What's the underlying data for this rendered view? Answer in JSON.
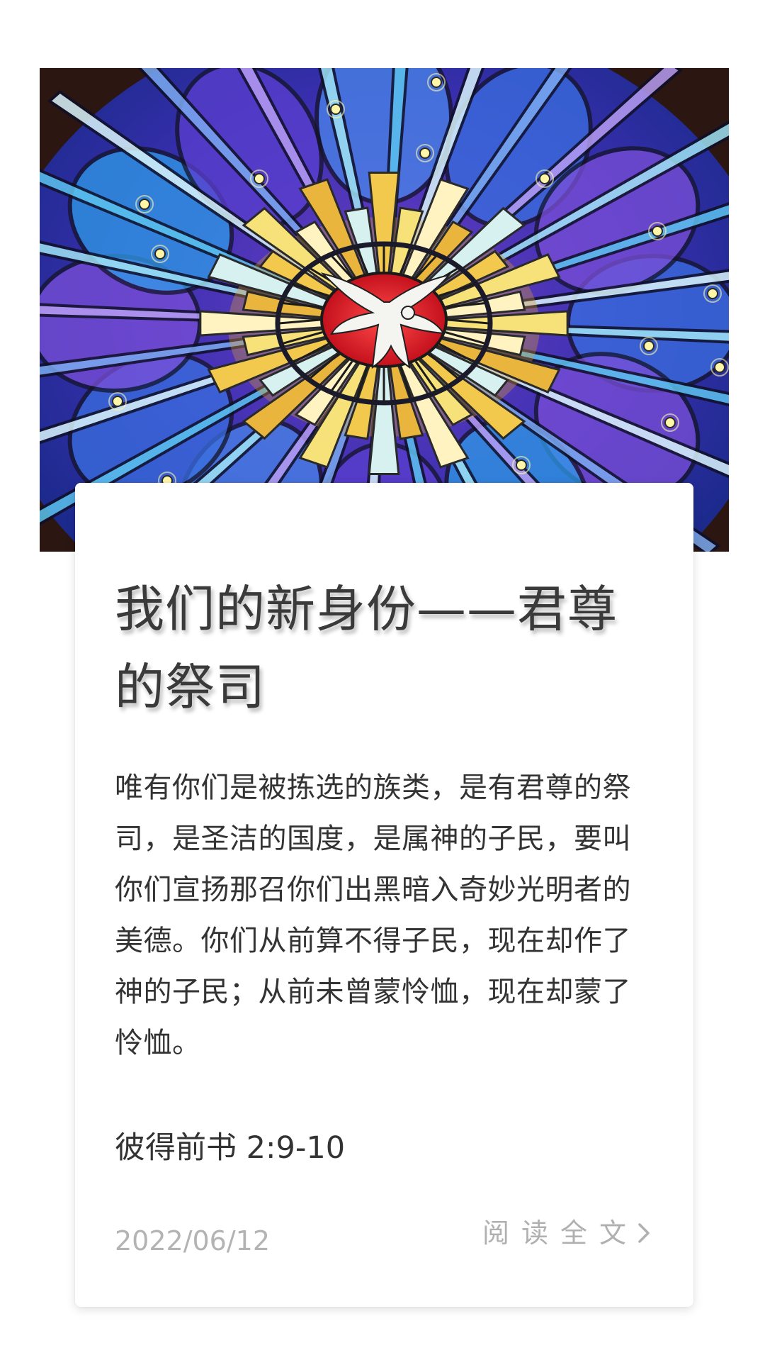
{
  "article": {
    "image_alt": "Stained glass window with dove",
    "title": "我们的新身份——君尊的祭司",
    "excerpt": "唯有你们是被拣选的族类，是有君尊的祭司，是圣洁的国度，是属神的子民，要叫你们宣扬那召你们出黑暗入奇妙光明者的美德。你们从前算不得子民，现在却作了神的子民；从前未曾蒙怜恤，现在却蒙了怜恤。",
    "reference": "彼得前书 2:9-10",
    "date": "2022/06/12",
    "read_more_label": "阅读全文",
    "read_more_icon": "chevron-right-icon"
  },
  "colors": {
    "card_background": "#ffffff",
    "title_text": "#3a3a3a",
    "body_text": "#333333",
    "muted_text": "#b3b3b3"
  }
}
